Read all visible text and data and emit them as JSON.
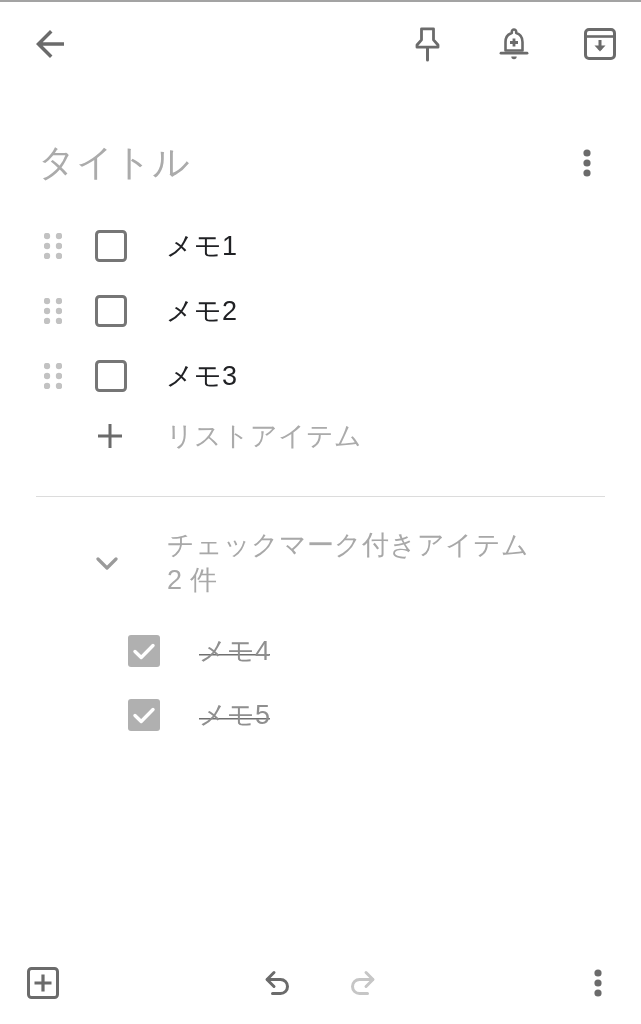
{
  "note": {
    "title": {
      "placeholder": "タイトル"
    },
    "items": [
      {
        "text": "メモ1",
        "checked": false
      },
      {
        "text": "メモ2",
        "checked": false
      },
      {
        "text": "メモ3",
        "checked": false
      }
    ],
    "add_item": {
      "label": "リストアイテム"
    },
    "checked_section": {
      "expanded": true,
      "label": "チェックマーク付きアイテム",
      "count": "2 件",
      "items": [
        {
          "text": "メモ4",
          "checked": true
        },
        {
          "text": "メモ5",
          "checked": true
        }
      ]
    }
  },
  "bottom_bar": {
    "undo": {
      "disabled": false
    },
    "redo": {
      "disabled": true
    }
  }
}
